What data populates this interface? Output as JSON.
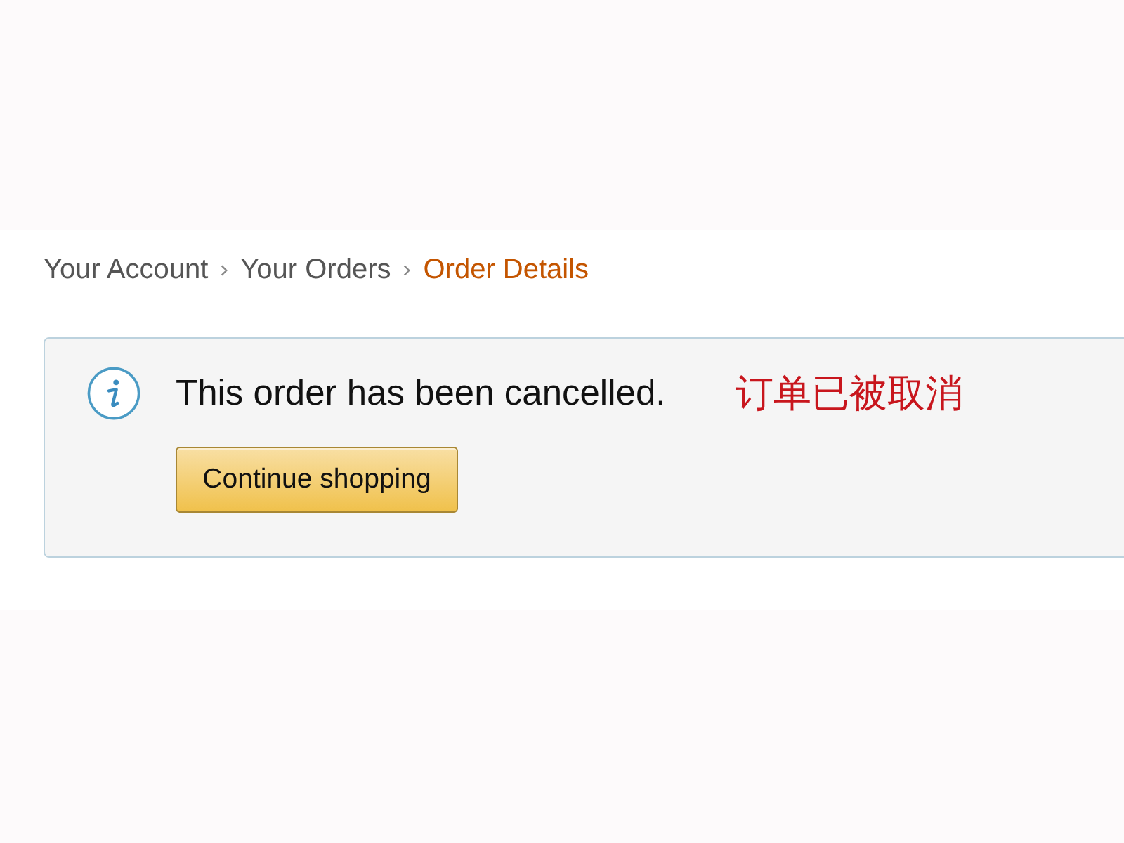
{
  "breadcrumb": [
    {
      "label": "Your Account",
      "selected": false
    },
    {
      "label": "Your Orders",
      "selected": false
    },
    {
      "label": "Order Details",
      "selected": true
    }
  ],
  "alert": {
    "kind": "info",
    "message": "This order has been cancelled.",
    "annotation": "订单已被取消",
    "button": "Continue shopping"
  }
}
